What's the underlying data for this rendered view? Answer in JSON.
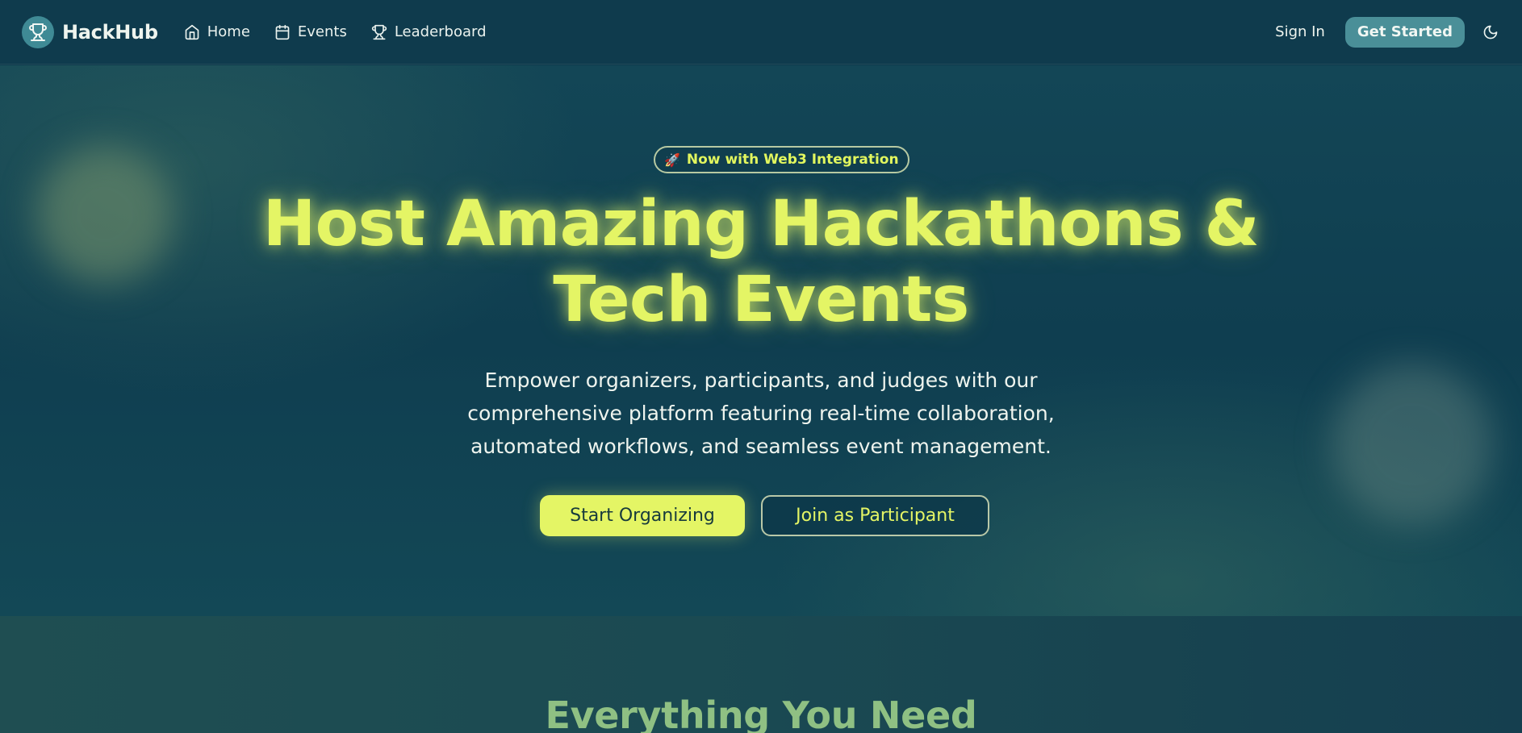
{
  "brand": {
    "name": "HackHub",
    "logo_icon": "trophy-icon"
  },
  "nav": {
    "items": [
      {
        "label": "Home",
        "icon": "home-icon"
      },
      {
        "label": "Events",
        "icon": "calendar-icon"
      },
      {
        "label": "Leaderboard",
        "icon": "trophy-icon"
      }
    ],
    "sign_in": "Sign In",
    "get_started": "Get Started",
    "theme_icon": "moon-icon"
  },
  "hero": {
    "badge_emoji": "🚀",
    "badge_text": "Now with Web3 Integration",
    "title_line1": "Host Amazing Hackathons &",
    "title_line2": "Tech Events",
    "description": "Empower organizers, participants, and judges with our comprehensive platform featuring real-time collaboration, automated workflows, and seamless event management.",
    "primary_button": "Start Organizing",
    "secondary_button": "Join as Participant"
  },
  "features": {
    "title": "Everything You Need"
  },
  "colors": {
    "accent": "#e4f565",
    "navbar_bg": "#0f3b4d",
    "button_teal": "#4a8f98",
    "section_title": "#8fc083"
  }
}
